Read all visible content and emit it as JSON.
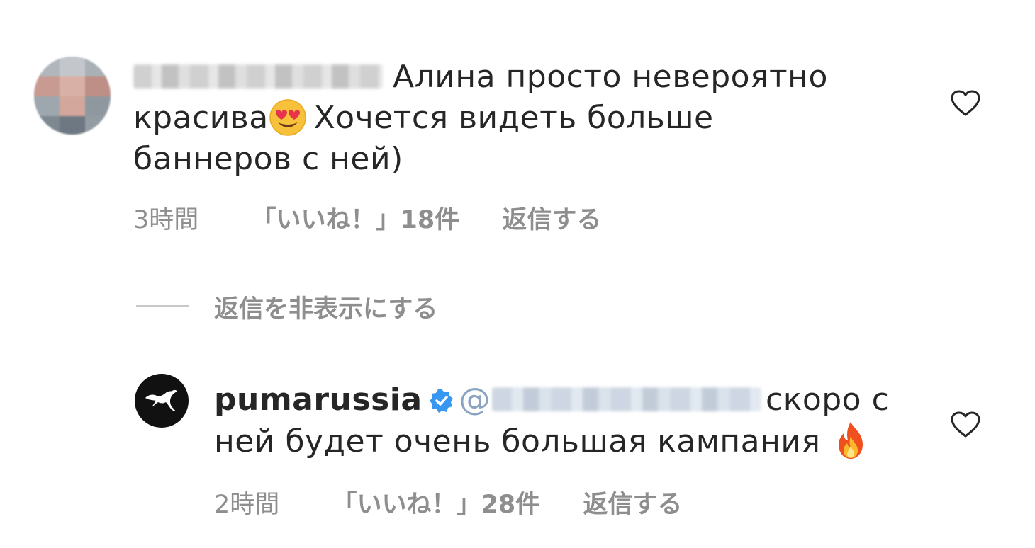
{
  "comments": [
    {
      "text_line1": "Алина просто невероятно",
      "text_line2_a": "красива",
      "emoji": "heart-eyes",
      "text_line2_b": "Хочется видеть больше",
      "text_line3": "баннеров с ней)",
      "time": "3時間",
      "likes": "「いいね！」18件",
      "reply": "返信する"
    }
  ],
  "hide_replies": "返信を非表示にする",
  "reply": {
    "username": "pumarussia",
    "verified": true,
    "mention_prefix": "@",
    "text_part1": "скоро с",
    "text_part2": "ней будет очень большая кампания",
    "emoji": "fire",
    "time": "2時間",
    "likes": "「いいね！」28件",
    "reply_action": "返信する"
  },
  "colors": {
    "text": "#262626",
    "meta": "#8e8e8e",
    "verified": "#3897f0",
    "avatar_bg": "#111111"
  }
}
